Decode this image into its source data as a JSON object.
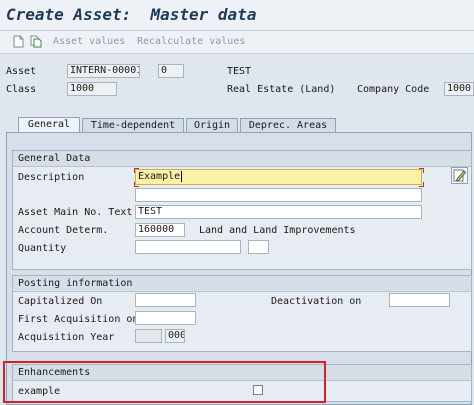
{
  "window": {
    "title": "Create Asset:  Master data"
  },
  "toolbar": {
    "icons": [
      "new-document-icon",
      "copy-document-icon"
    ],
    "asset_values": "Asset values",
    "recalculate_values": "Recalculate values"
  },
  "header": {
    "asset_label": "Asset",
    "asset_number": "INTERN-00001",
    "sub_number": "0",
    "asset_text": "TEST",
    "class_label": "Class",
    "class_value": "1000",
    "class_text": "Real Estate (Land)",
    "company_code_label": "Company Code",
    "company_code_value": "1000"
  },
  "tabs": [
    {
      "label": "General",
      "active": true
    },
    {
      "label": "Time-dependent",
      "active": false
    },
    {
      "label": "Origin",
      "active": false
    },
    {
      "label": "Deprec. Areas",
      "active": false
    }
  ],
  "general_data": {
    "title": "General Data",
    "description_label": "Description",
    "description_value": "Example",
    "description_line2": "",
    "main_no_text_label": "Asset Main No. Text",
    "main_no_text_value": "TEST",
    "account_determ_label": "Account Determ.",
    "account_determ_value": "160000",
    "account_determ_text": "Land and Land Improvements",
    "quantity_label": "Quantity",
    "quantity_value": "",
    "quantity_unit": ""
  },
  "posting_info": {
    "title": "Posting information",
    "capitalized_on_label": "Capitalized On",
    "capitalized_on_value": "",
    "deactivation_on_label": "Deactivation on",
    "deactivation_on_value": "",
    "first_acquisition_label": "First Acquisition on",
    "first_acquisition_value": "",
    "acquisition_year_label": "Acquisition Year",
    "acquisition_year_value": "",
    "acquisition_period": "000"
  },
  "enhancements": {
    "title": "Enhancements",
    "example_label": "example",
    "example_checked": false
  },
  "colors": {
    "highlight_border": "#d4202a",
    "focus_field_bg": "#fbf1a8"
  }
}
